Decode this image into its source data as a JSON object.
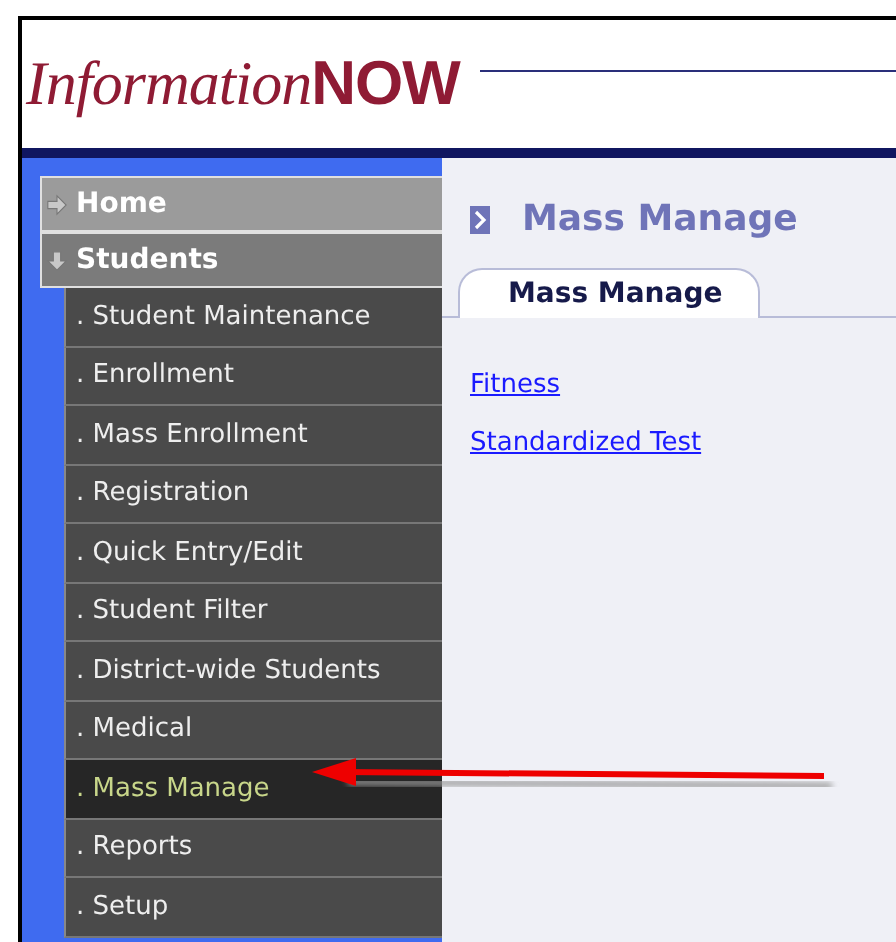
{
  "logo": {
    "script_part": "Information",
    "bold_part": "NOW"
  },
  "sidebar": {
    "sections": [
      {
        "label": "Home",
        "expanded": false
      },
      {
        "label": "Students",
        "expanded": true,
        "children": [
          {
            "label": ". Student Maintenance",
            "selected": false
          },
          {
            "label": ". Enrollment",
            "selected": false
          },
          {
            "label": ". Mass Enrollment",
            "selected": false
          },
          {
            "label": ". Registration",
            "selected": false
          },
          {
            "label": ". Quick Entry/Edit",
            "selected": false
          },
          {
            "label": ". Student Filter",
            "selected": false
          },
          {
            "label": ". District-wide Students",
            "selected": false
          },
          {
            "label": ". Medical",
            "selected": false
          },
          {
            "label": ". Mass Manage",
            "selected": true
          },
          {
            "label": ". Reports",
            "selected": false
          },
          {
            "label": ". Setup",
            "selected": false
          }
        ]
      }
    ]
  },
  "page_title": "Mass Manage",
  "tabs": [
    {
      "label": "Mass Manage",
      "selected": true
    }
  ],
  "links": [
    "Fitness",
    "Standardized Test"
  ]
}
